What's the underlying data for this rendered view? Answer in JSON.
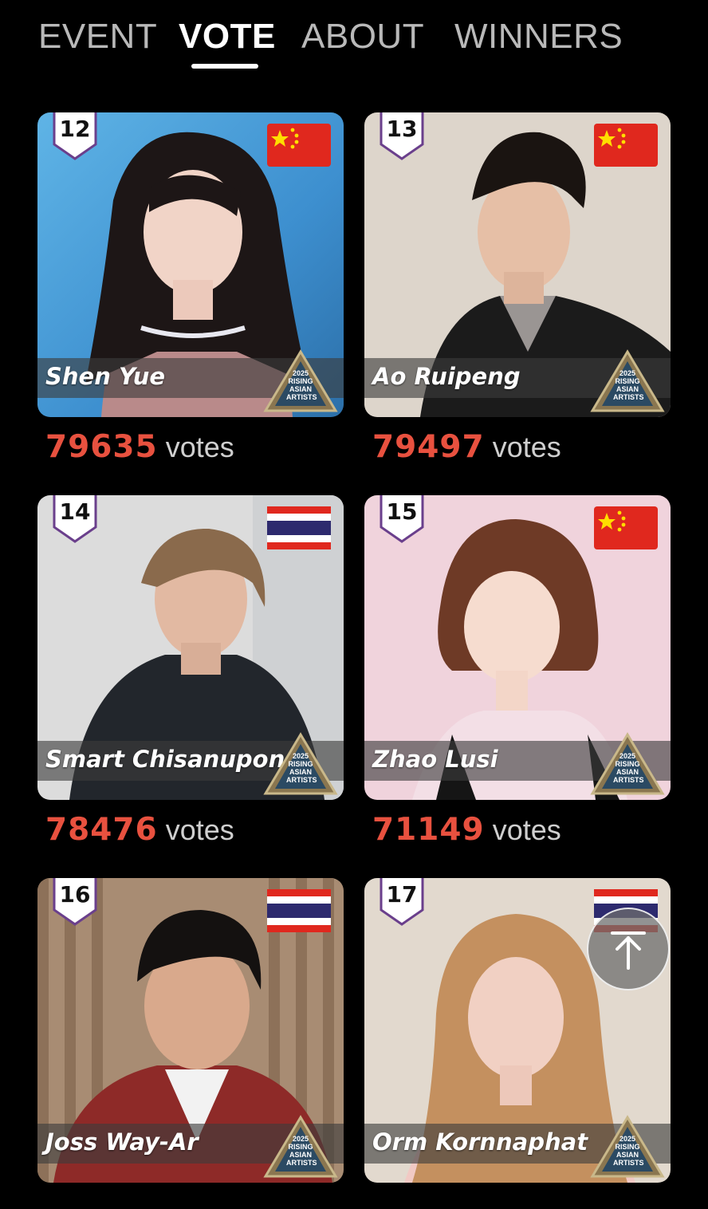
{
  "tabs": [
    {
      "label": "EVENT",
      "active": false
    },
    {
      "label": "VOTE",
      "active": true
    },
    {
      "label": "ABOUT",
      "active": false
    },
    {
      "label": "WINNERS",
      "active": false
    }
  ],
  "award_badge": {
    "lines": [
      "2025",
      "RISING",
      "ASIAN",
      "ARTISTS"
    ]
  },
  "colors": {
    "vote_number": "#e8513f",
    "badge_outline": "#6a3f8c"
  },
  "votes_unit": "votes",
  "artists": [
    {
      "rank": "12",
      "name": "Shen Yue",
      "flag": "china-flag-icon",
      "votes": "79635"
    },
    {
      "rank": "13",
      "name": "Ao Ruipeng",
      "flag": "china-flag-icon",
      "votes": "79497"
    },
    {
      "rank": "14",
      "name": "Smart Chisanupong",
      "flag": "thailand-flag-icon",
      "votes": "78476"
    },
    {
      "rank": "15",
      "name": "Zhao Lusi",
      "flag": "china-flag-icon",
      "votes": "71149"
    },
    {
      "rank": "16",
      "name": "Joss Way-Ar",
      "flag": "thailand-flag-icon",
      "votes": ""
    },
    {
      "rank": "17",
      "name": "Orm Kornnaphat",
      "flag": "thailand-flag-icon",
      "votes": ""
    }
  ],
  "scroll_top": {
    "icon": "arrow-up-icon"
  }
}
